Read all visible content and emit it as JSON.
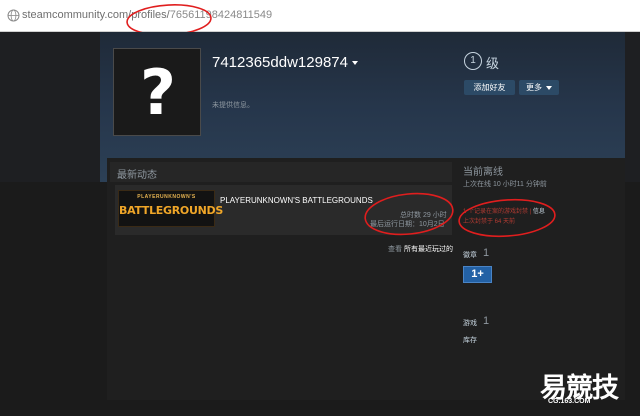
{
  "browser": {
    "url_prefix": "steamcommunity.com/profiles/",
    "url_id": "76561198424811549"
  },
  "profile": {
    "avatar_placeholder": "?",
    "username": "7412365ddw129874",
    "summary": "未提供信息。",
    "level": "1",
    "level_label": "级",
    "add_friend_label": "添加好友",
    "more_label": "更多"
  },
  "activity": {
    "title": "最新动态",
    "game": {
      "name": "PLAYERUNKNOWN'S BATTLEGROUNDS",
      "capsule_top": "PLAYERUNKNOWN'S",
      "capsule_main": "BATTLEGROUNDS",
      "hours": "总时数 29 小时",
      "last_played": "最后运行日期：10月2日"
    },
    "view_all_prefix": "查看",
    "view_all_link": "所有最近玩过的"
  },
  "sidebar": {
    "status": "当前离线",
    "last_online": "上次在线 10 小时11 分钟前",
    "ban_record": "1 个记录在案的游戏封禁",
    "ban_separator": "|",
    "ban_info": "信息",
    "ban_last": "上次封禁于 64 天前",
    "badges_label": "徽章",
    "badges_count": "1",
    "badge_icon_text": "1+",
    "games_label": "游戏",
    "games_count": "1",
    "library_label": "库存"
  },
  "watermark": {
    "logo": "易競技",
    "url": "CG.163.COM"
  },
  "colors": {
    "annotation": "#e01e1e",
    "ban_red": "#b33b32",
    "badge_blue": "#2361a5",
    "pubg_orange": "#f0a628"
  }
}
